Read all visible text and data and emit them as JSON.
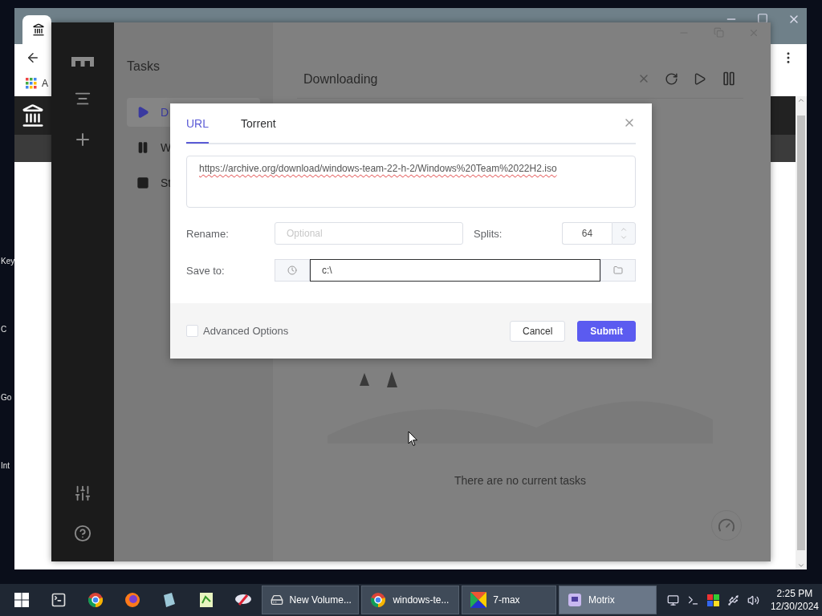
{
  "desktop": {
    "icon_labels": [
      "Key",
      "C",
      "Go",
      "Int"
    ]
  },
  "browser": {
    "bookmark_label": "A"
  },
  "motrix": {
    "list_title": "Tasks",
    "task_lists": [
      {
        "label": "D",
        "kind": "active",
        "selected": true
      },
      {
        "label": "W",
        "kind": "waiting",
        "selected": false
      },
      {
        "label": "St",
        "kind": "stopped",
        "selected": false
      }
    ],
    "heading": "Downloading",
    "empty_message": "There are no current tasks"
  },
  "dialog": {
    "tabs": [
      {
        "label": "URL",
        "selected": true
      },
      {
        "label": "Torrent",
        "selected": false
      }
    ],
    "url": "https://archive.org/download/windows-team-22-h-2/Windows%20Team%2022H2.iso",
    "rename": {
      "label": "Rename:",
      "placeholder": "Optional"
    },
    "splits": {
      "label": "Splits:",
      "value": "64"
    },
    "save_to": {
      "label": "Save to:",
      "value": "c:\\"
    },
    "advanced": {
      "label": "Advanced Options",
      "checked": false
    },
    "buttons": [
      {
        "label": "Cancel",
        "kind": "secondary"
      },
      {
        "label": "Submit",
        "kind": "primary"
      }
    ]
  },
  "taskbar": {
    "windows": [
      {
        "label": "New Volume...",
        "kind": "drive",
        "selected": false
      },
      {
        "label": "windows-te...",
        "kind": "chrome",
        "selected": false
      },
      {
        "label": "7-max",
        "kind": "cube",
        "selected": false
      },
      {
        "label": "Motrix",
        "kind": "motrix",
        "selected": true
      }
    ],
    "time": "2:25 PM",
    "date": "12/30/2024"
  }
}
